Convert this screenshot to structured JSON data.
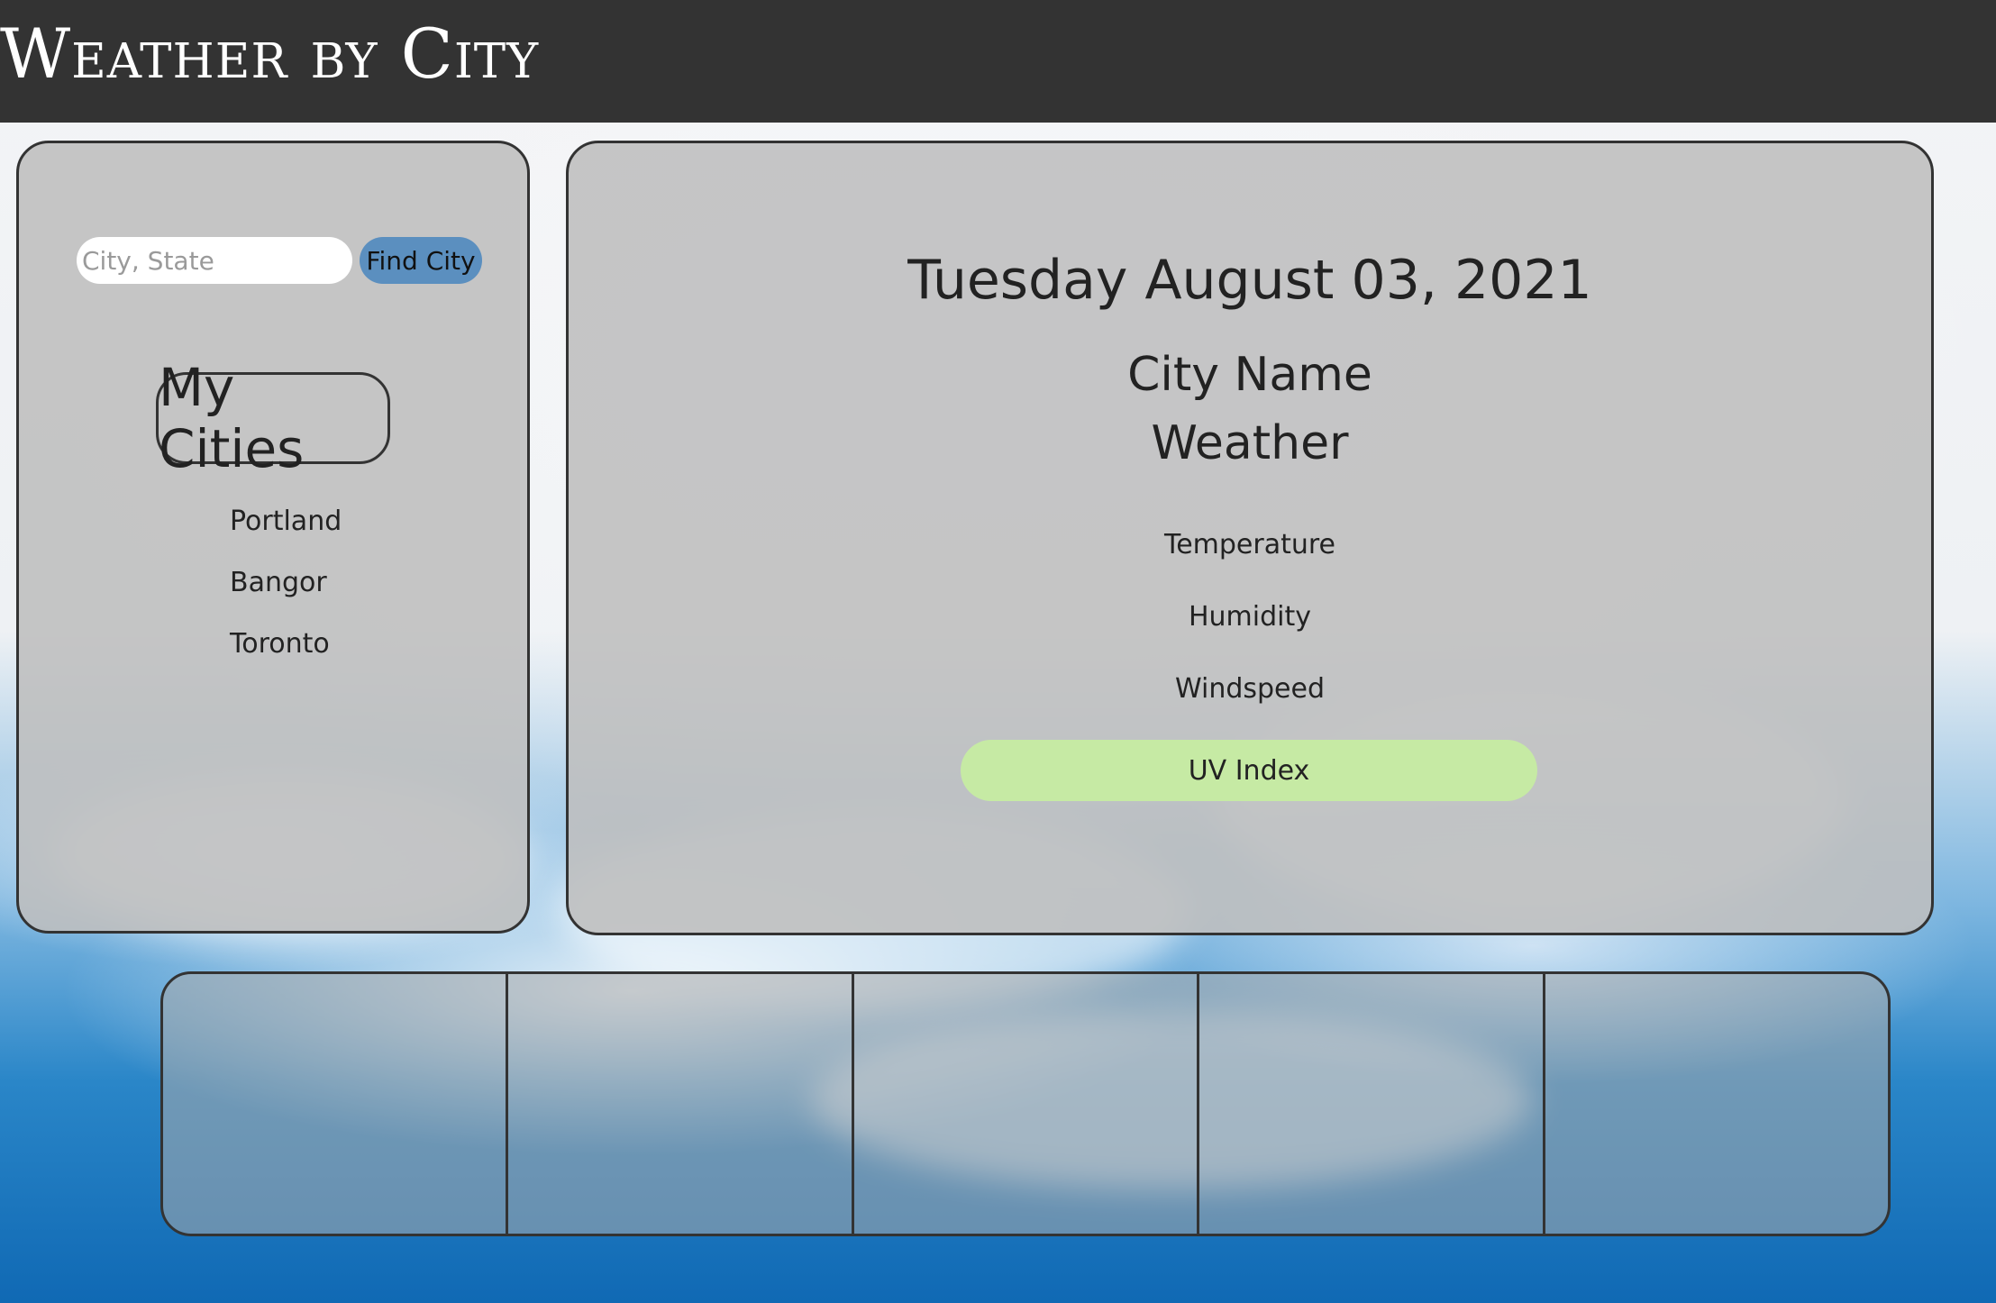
{
  "header": {
    "title": "Weather by City"
  },
  "sidebar": {
    "search": {
      "placeholder": "City, State",
      "value": ""
    },
    "find_button_label": "Find City",
    "my_cities_label": "My Cities",
    "cities": [
      "Portland",
      "Bangor",
      "Toronto"
    ]
  },
  "main": {
    "date": "Tuesday August 03, 2021",
    "city_name": "City Name",
    "weather": "Weather",
    "temperature_label": "Temperature",
    "humidity_label": "Humidity",
    "windspeed_label": "Windspeed",
    "uv_index_label": "UV Index"
  },
  "forecast": {
    "days": [
      "",
      "",
      "",
      "",
      ""
    ]
  },
  "colors": {
    "header_bg": "#333333",
    "find_button_bg": "#5b8fbf",
    "uv_index_bg": "#c6eaa4",
    "panel_border": "#333333"
  }
}
